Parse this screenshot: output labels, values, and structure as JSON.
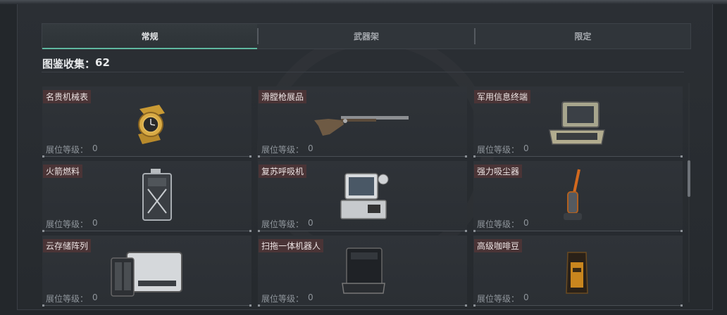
{
  "tabs": [
    {
      "label": "常规",
      "active": true
    },
    {
      "label": "武器架",
      "active": false
    },
    {
      "label": "限定",
      "active": false
    }
  ],
  "collection": {
    "label": "图鉴收集：",
    "count": "62"
  },
  "level_label": "展位等级：",
  "items": [
    {
      "name": "名贵机械表",
      "level": "0",
      "icon": "gold-watch-icon"
    },
    {
      "name": "滑膛枪展品",
      "level": "0",
      "icon": "musket-icon"
    },
    {
      "name": "军用信息终端",
      "level": "0",
      "icon": "military-terminal-icon"
    },
    {
      "name": "火箭燃料",
      "level": "0",
      "icon": "fuel-canister-icon"
    },
    {
      "name": "复苏呼吸机",
      "level": "0",
      "icon": "ventilator-icon"
    },
    {
      "name": "强力吸尘器",
      "level": "0",
      "icon": "vacuum-cleaner-icon"
    },
    {
      "name": "云存储阵列",
      "level": "0",
      "icon": "storage-array-icon"
    },
    {
      "name": "扫拖一体机器人",
      "level": "0",
      "icon": "mopping-robot-icon"
    },
    {
      "name": "高级咖啡豆",
      "level": "0",
      "icon": "coffee-bag-icon"
    }
  ],
  "colors": {
    "accent": "#5fb8a0",
    "name_bg": "#4a3436",
    "background": "#23272b"
  }
}
